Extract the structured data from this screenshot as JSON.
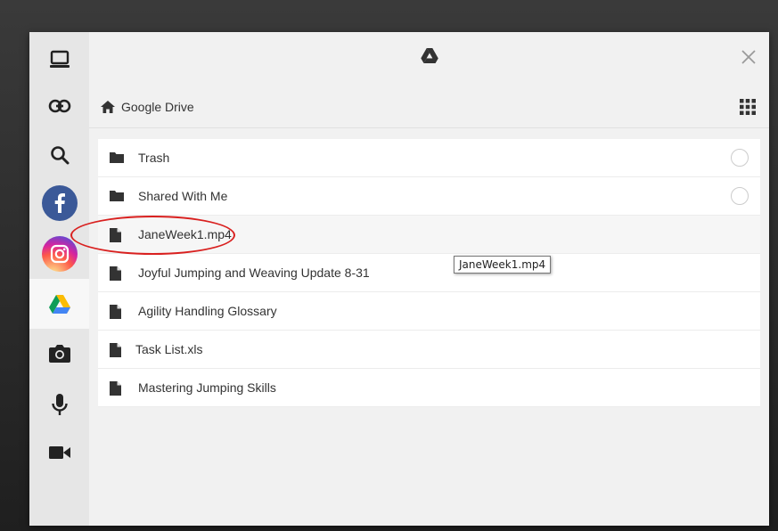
{
  "header": {
    "logo_icon": "google-drive-icon",
    "close_icon": "close-icon"
  },
  "breadcrumb": {
    "home_icon": "home-icon",
    "label": "Google Drive",
    "view_toggle_icon": "grid-view-icon"
  },
  "sidebar": {
    "items": [
      {
        "name": "device",
        "icon": "laptop-icon"
      },
      {
        "name": "link",
        "icon": "link-icon"
      },
      {
        "name": "search",
        "icon": "search-icon"
      },
      {
        "name": "facebook",
        "icon": "facebook-icon",
        "color": "#3b5998"
      },
      {
        "name": "instagram",
        "icon": "instagram-icon"
      },
      {
        "name": "google-drive",
        "icon": "google-drive-icon",
        "active": true
      },
      {
        "name": "camera",
        "icon": "camera-icon"
      },
      {
        "name": "audio",
        "icon": "microphone-icon"
      },
      {
        "name": "video",
        "icon": "video-camera-icon"
      }
    ]
  },
  "files": [
    {
      "label": "Trash",
      "type": "folder",
      "selectable": true
    },
    {
      "label": "Shared With Me",
      "type": "folder",
      "selectable": true
    },
    {
      "label": "JaneWeek1.mp4",
      "type": "file",
      "hovered": true,
      "circled": true
    },
    {
      "label": "Joyful Jumping and Weaving Update 8-31",
      "type": "file"
    },
    {
      "label": "Agility Handling Glossary",
      "type": "file"
    },
    {
      "label": "Task List.xls",
      "type": "file"
    },
    {
      "label": "Mastering Jumping Skills",
      "type": "file"
    }
  ],
  "tooltip": {
    "text": "JaneWeek1.mp4"
  },
  "colors": {
    "annotation_circle": "#d9201f",
    "facebook": "#3b5998",
    "sidebar_bg": "#e6e6e6",
    "panel_bg": "#f1f1f1"
  }
}
